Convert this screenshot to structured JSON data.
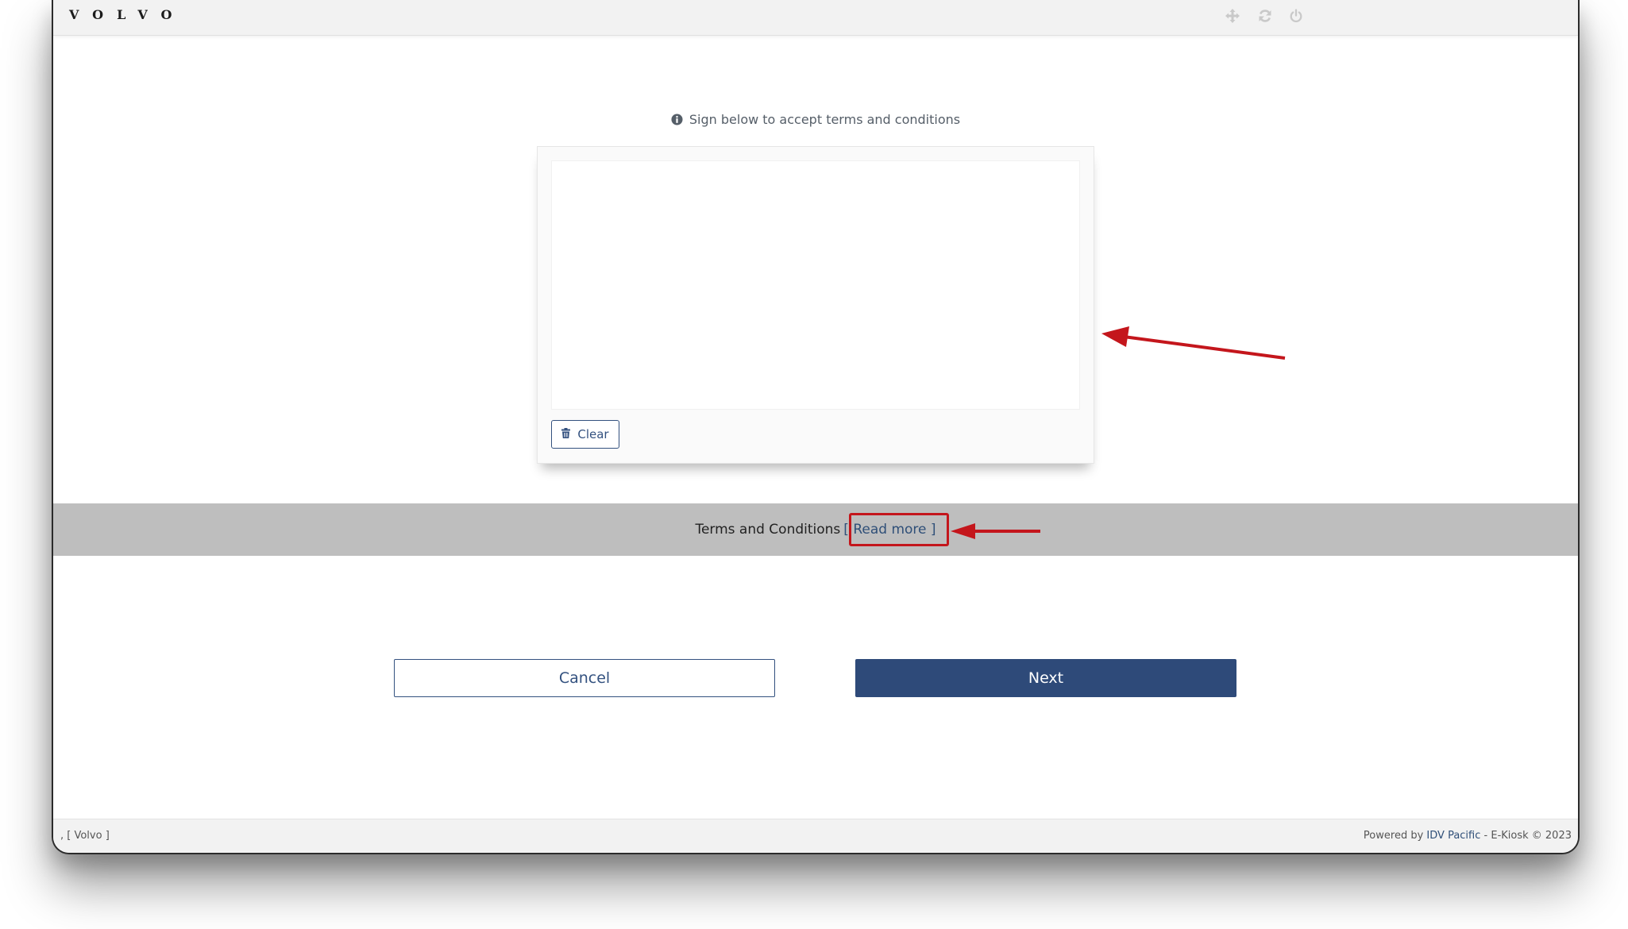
{
  "header": {
    "logo_text": "VOLVO",
    "icons": [
      "move-icon",
      "refresh-icon",
      "power-icon"
    ]
  },
  "signature": {
    "prompt": "Sign below to accept terms and conditions",
    "clear_label": "Clear"
  },
  "terms": {
    "label": "Terms and Conditions",
    "read_more": "[ Read more ]"
  },
  "actions": {
    "cancel_label": "Cancel",
    "next_label": "Next"
  },
  "footer": {
    "left_text": ", [ Volvo ]",
    "powered_prefix": "Powered by",
    "powered_link": "IDV Pacific",
    "powered_suffix": "- E-Kiosk © 2023"
  },
  "colors": {
    "primary": "#2e4a79",
    "terms_bar": "#bebebe",
    "annotation": "#c4161c"
  }
}
